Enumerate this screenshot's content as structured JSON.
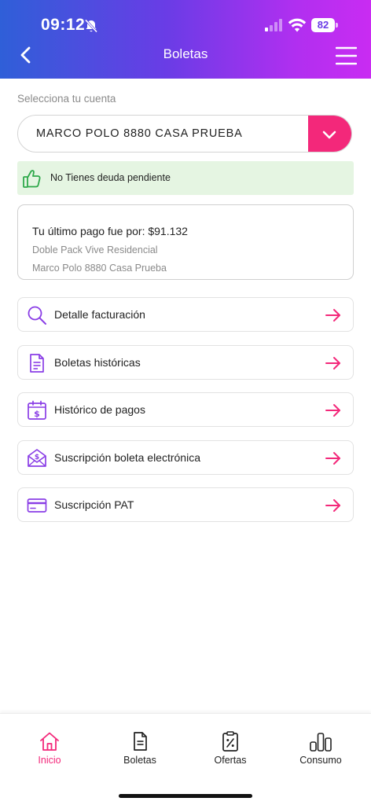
{
  "status_bar": {
    "time": "09:12",
    "battery": "82"
  },
  "header": {
    "title": "Boletas"
  },
  "account": {
    "label": "Selecciona tu cuenta",
    "selected": "MARCO POLO 8880 CASA PRUEBA"
  },
  "debt_banner": {
    "text": "No Tienes deuda pendiente"
  },
  "last_payment": {
    "amount_text": "Tu último pago fue por: $91.132",
    "plan": "Doble Pack Vive Residencial",
    "address": "Marco Polo 8880 Casa Prueba"
  },
  "menu_items": [
    {
      "label": "Detalle facturación",
      "icon": "magnifier-icon"
    },
    {
      "label": "Boletas históricas",
      "icon": "document-icon"
    },
    {
      "label": "Histórico de pagos",
      "icon": "calendar-dollar-icon"
    },
    {
      "label": "Suscripción boleta electrónica",
      "icon": "envelope-dollar-icon"
    },
    {
      "label": "Suscripción PAT",
      "icon": "credit-card-icon"
    }
  ],
  "bottom_nav": [
    {
      "label": "Inicio",
      "icon": "home-icon",
      "active": true
    },
    {
      "label": "Boletas",
      "icon": "receipt-icon",
      "active": false
    },
    {
      "label": "Ofertas",
      "icon": "offer-clipboard-icon",
      "active": false
    },
    {
      "label": "Consumo",
      "icon": "bar-chart-icon",
      "active": false
    }
  ],
  "colors": {
    "accent": "#f3287a",
    "icon_purple": "#8a3ee6",
    "success_bg": "#e5f5e2",
    "success_icon": "#2ea84a",
    "header_gradient_start": "#2f5fd8",
    "header_gradient_end": "#c92cf2"
  }
}
